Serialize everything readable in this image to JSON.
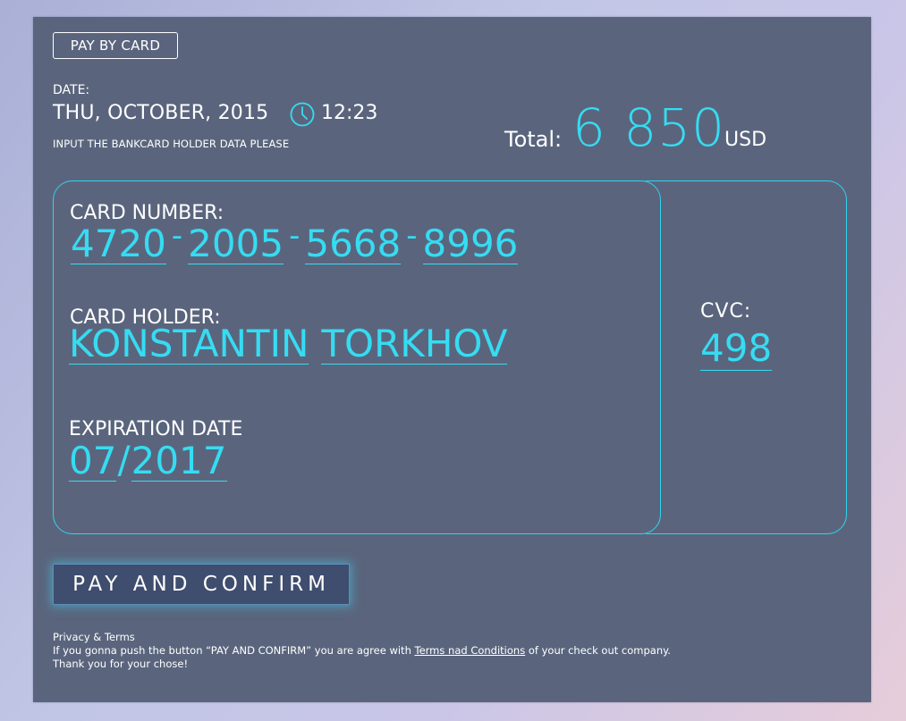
{
  "header": {
    "pay_by_card_label": "PAY BY CARD",
    "date_label": "DATE:",
    "date_value": "THU, OCTOBER, 2015",
    "time_value": "12:23",
    "clock_icon": "clock-icon",
    "instruction": "INPUT THE BANKCARD HOLDER DATA PLEASE"
  },
  "total": {
    "label": "Total:",
    "amount": "6 850",
    "currency": "USD"
  },
  "card": {
    "number_label": "CARD NUMBER:",
    "number_groups": [
      "4720",
      "2005",
      "5668",
      "8996"
    ],
    "separator": "-",
    "holder_label": "CARD HOLDER:",
    "holder_first": "KONSTANTIN",
    "holder_last": "TORKHOV",
    "expiration_label": "EXPIRATION DATE",
    "exp_month": "07",
    "exp_slash": "/",
    "exp_year": "2017",
    "cvc_label": "CVC:",
    "cvc_value": "498"
  },
  "actions": {
    "confirm_label": "PAY AND CONFIRM"
  },
  "footer": {
    "privacy": "Privacy & Terms",
    "terms_prefix": "If you gonna push the button “PAY AND CONFIRM” you are agree with ",
    "terms_link": "Terms nad Conditions",
    "terms_suffix": " of your check out company.",
    "thanks": "Thank you for your chose!"
  },
  "colors": {
    "panel_bg": "#5a657d",
    "accent_cyan": "#35dcf2",
    "button_bg": "#3f4d6e",
    "text": "#ffffff"
  }
}
